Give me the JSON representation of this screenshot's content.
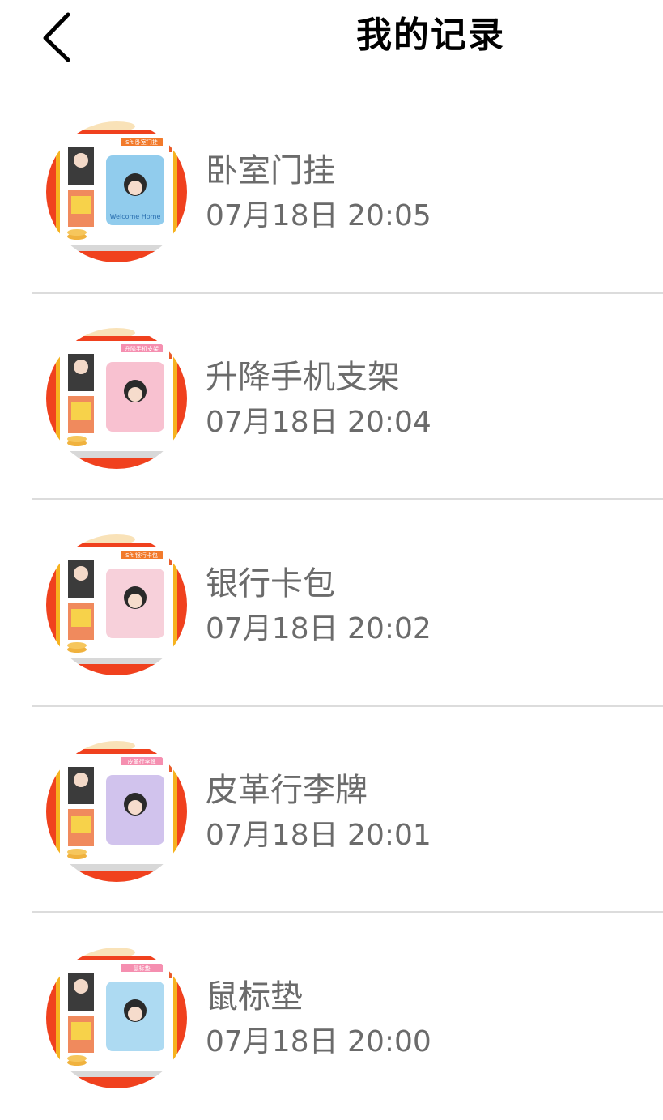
{
  "header": {
    "title": "我的记录",
    "back_icon": "chevron-left-icon"
  },
  "records": [
    {
      "name": "卧室门挂",
      "time": "07月18日 20:05",
      "tag": "Sft 卧室门挂",
      "product_text": "Welcome Home",
      "tag_color": "#f27a2b",
      "product_color": "#7ec3ea"
    },
    {
      "name": "升降手机支架",
      "time": "07月18日 20:04",
      "tag": "升降手机支架",
      "product_text": "",
      "tag_color": "#f58fb0",
      "product_color": "#f7b6c8"
    },
    {
      "name": "银行卡包",
      "time": "07月18日 20:02",
      "tag": "Sft 银行卡包",
      "product_text": "",
      "tag_color": "#f27a2b",
      "product_color": "#f6c8d4"
    },
    {
      "name": "皮革行李牌",
      "time": "07月18日 20:01",
      "tag": "皮革行李牌",
      "product_text": "",
      "tag_color": "#f58fb0",
      "product_color": "#c9b8ea"
    },
    {
      "name": "鼠标垫",
      "time": "07月18日 20:00",
      "tag": "鼠标垫",
      "product_text": "",
      "tag_color": "#f58fb0",
      "product_color": "#9fd4f0"
    }
  ]
}
